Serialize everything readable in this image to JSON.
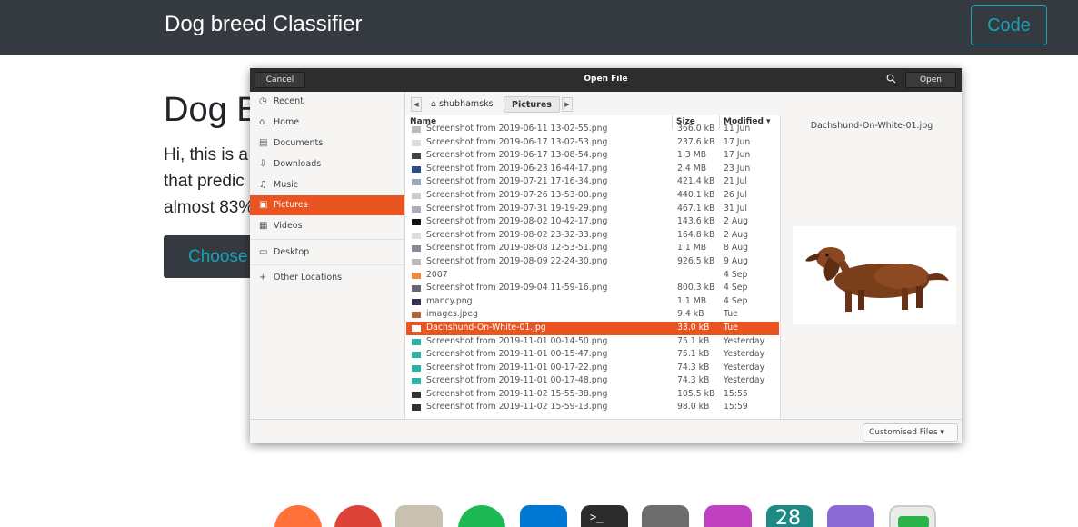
{
  "navbar": {
    "brand": "Dog breed Classifier",
    "code_button": "Code"
  },
  "page": {
    "heading": "Dog B",
    "description_lines": [
      "Hi, this is a",
      "that predic",
      "almost 83%"
    ],
    "choose_button": "Choose"
  },
  "dialog": {
    "title": "Open File",
    "cancel_label": "Cancel",
    "open_label": "Open",
    "sidebar": [
      {
        "label": "Recent",
        "icon": "clock-icon"
      },
      {
        "label": "Home",
        "icon": "home-icon"
      },
      {
        "label": "Documents",
        "icon": "document-icon"
      },
      {
        "label": "Downloads",
        "icon": "download-icon"
      },
      {
        "label": "Music",
        "icon": "music-icon"
      },
      {
        "label": "Pictures",
        "icon": "picture-icon",
        "active": true
      },
      {
        "label": "Videos",
        "icon": "video-icon"
      },
      {
        "label": "Desktop",
        "icon": "desktop-icon"
      },
      {
        "label": "Other Locations",
        "icon": "plus-icon"
      }
    ],
    "path": {
      "home": "shubhamsks",
      "current": "Pictures"
    },
    "columns": {
      "name": "Name",
      "size": "Size",
      "modified": "Modified"
    },
    "files": [
      {
        "name": "Screenshot from 2019-06-11 13-02-55.png",
        "size": "366.0 kB",
        "modified": "11 Jun",
        "icon": "#bbb"
      },
      {
        "name": "Screenshot from 2019-06-17 13-02-53.png",
        "size": "237.6 kB",
        "modified": "17 Jun",
        "icon": "#ddd"
      },
      {
        "name": "Screenshot from 2019-06-17 13-08-54.png",
        "size": "1.3 MB",
        "modified": "17 Jun",
        "icon": "#444"
      },
      {
        "name": "Screenshot from 2019-06-23 16-44-17.png",
        "size": "2.4 MB",
        "modified": "23 Jun",
        "icon": "#2c4a8a"
      },
      {
        "name": "Screenshot from 2019-07-21 17-16-34.png",
        "size": "421.4 kB",
        "modified": "21 Jul",
        "icon": "#9ab"
      },
      {
        "name": "Screenshot from 2019-07-26 13-53-00.png",
        "size": "440.1 kB",
        "modified": "26 Jul",
        "icon": "#ccc"
      },
      {
        "name": "Screenshot from 2019-07-31 19-19-29.png",
        "size": "467.1 kB",
        "modified": "31 Jul",
        "icon": "#aab"
      },
      {
        "name": "Screenshot from 2019-08-02 10-42-17.png",
        "size": "143.6 kB",
        "modified": "2 Aug",
        "icon": "#111"
      },
      {
        "name": "Screenshot from 2019-08-02 23-32-33.png",
        "size": "164.8 kB",
        "modified": "2 Aug",
        "icon": "#ddd"
      },
      {
        "name": "Screenshot from 2019-08-08 12-53-51.png",
        "size": "1.1 MB",
        "modified": "8 Aug",
        "icon": "#889"
      },
      {
        "name": "Screenshot from 2019-08-09 22-24-30.png",
        "size": "926.5 kB",
        "modified": "9 Aug",
        "icon": "#bbb"
      },
      {
        "name": "2007",
        "size": "",
        "modified": "4 Sep",
        "icon": "#f08a3a"
      },
      {
        "name": "Screenshot from 2019-09-04 11-59-16.png",
        "size": "800.3 kB",
        "modified": "4 Sep",
        "icon": "#667"
      },
      {
        "name": "mancy.png",
        "size": "1.1 MB",
        "modified": "4 Sep",
        "icon": "#335"
      },
      {
        "name": "images.jpeg",
        "size": "9.4 kB",
        "modified": "Tue",
        "icon": "#b5653a"
      },
      {
        "name": "Dachshund-On-White-01.jpg",
        "size": "33.0 kB",
        "modified": "Tue",
        "icon": "#fff",
        "selected": true
      },
      {
        "name": "Screenshot from 2019-11-01 00-14-50.png",
        "size": "75.1 kB",
        "modified": "Yesterday",
        "icon": "#2bb3a8"
      },
      {
        "name": "Screenshot from 2019-11-01 00-15-47.png",
        "size": "75.1 kB",
        "modified": "Yesterday",
        "icon": "#2bb3a8"
      },
      {
        "name": "Screenshot from 2019-11-01 00-17-22.png",
        "size": "74.3 kB",
        "modified": "Yesterday",
        "icon": "#2bb3a8"
      },
      {
        "name": "Screenshot from 2019-11-01 00-17-48.png",
        "size": "74.3 kB",
        "modified": "Yesterday",
        "icon": "#2bb3a8"
      },
      {
        "name": "Screenshot from 2019-11-02 15-55-38.png",
        "size": "105.5 kB",
        "modified": "15:55",
        "icon": "#333"
      },
      {
        "name": "Screenshot from 2019-11-02 15-59-13.png",
        "size": "98.0 kB",
        "modified": "15:59",
        "icon": "#333"
      }
    ],
    "preview_name": "Dachshund-On-White-01.jpg",
    "filter_label": "Customised Files"
  },
  "dock": [
    {
      "name": "firefox-icon",
      "color": "#ff7139"
    },
    {
      "name": "chrome-icon",
      "color": "#db4437"
    },
    {
      "name": "files-icon",
      "color": "#c9c1b0"
    },
    {
      "name": "spotify-icon",
      "color": "#1db954"
    },
    {
      "name": "vscode-icon",
      "color": "#0078d4"
    },
    {
      "name": "terminal-icon",
      "color": "#2c2c2c"
    },
    {
      "name": "settings-icon",
      "color": "#6d6d6d"
    },
    {
      "name": "videos-icon",
      "color": "#c041c0"
    },
    {
      "name": "calendar-icon",
      "color": "#1f8a85"
    },
    {
      "name": "notes-icon",
      "color": "#8a6bd6"
    },
    {
      "name": "toggle-icon",
      "color": "#e8ece8"
    }
  ],
  "dock_calendar_day": "28"
}
